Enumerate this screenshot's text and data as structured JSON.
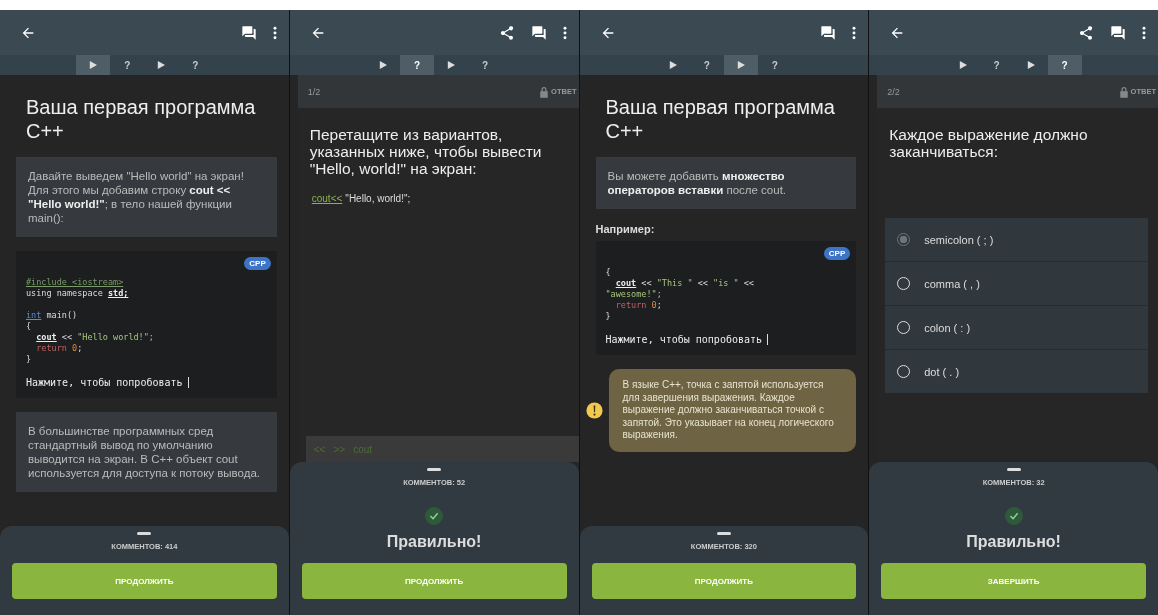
{
  "screens": [
    {
      "kind": "lesson",
      "share": false,
      "steps": [
        {
          "kind": "lesson",
          "selected": true
        },
        {
          "kind": "quiz",
          "label": "?",
          "selected": false
        },
        {
          "kind": "lesson",
          "selected": false
        },
        {
          "kind": "quiz",
          "label": "?",
          "selected": false
        }
      ],
      "title": "Ваша первая программа C++",
      "blocks": [
        {
          "kind": "note",
          "text": "Давайте выведем \"Hello world\" на экран! Для этого мы добавим строку **cout << \"Hello world!\"**; в тело нашей функции main():"
        },
        {
          "kind": "code",
          "lang": "CPP",
          "try_label": "Нажмите, чтобы попробовать",
          "lines": [
            {
              "indented": false,
              "blank_before": false,
              "tokens": [
                {
                  "text": "#include",
                  "kind": "ref"
                },
                {
                  "text": " <iostream>",
                  "kind": "ref"
                }
              ]
            },
            {
              "indented": false,
              "blank_before": false,
              "tokens": [
                {
                  "text": "using namespace ",
                  "kind": "plain"
                },
                {
                  "text": "std;",
                  "kind": "var"
                }
              ]
            },
            {
              "indented": false,
              "blank_before": true,
              "tokens": [
                {
                  "text": "int",
                  "kind": "type"
                },
                {
                  "text": " main()",
                  "kind": "plain"
                }
              ]
            },
            {
              "indented": false,
              "blank_before": false,
              "tokens": [
                {
                  "text": "{",
                  "kind": "plain"
                }
              ]
            },
            {
              "indented": true,
              "blank_before": false,
              "tokens": [
                {
                  "text": "cout",
                  "kind": "var"
                },
                {
                  "text": " << ",
                  "kind": "plain"
                },
                {
                  "text": "\"Hello world!\";",
                  "kind": "string"
                }
              ]
            },
            {
              "indented": true,
              "blank_before": false,
              "tokens": [
                {
                  "text": "return",
                  "kind": "keyword"
                },
                {
                  "text": " 0",
                  "kind": "number"
                },
                {
                  "text": ";",
                  "kind": "plain"
                }
              ]
            },
            {
              "indented": false,
              "blank_before": false,
              "tokens": [
                {
                  "text": "}",
                  "kind": "plain"
                }
              ]
            }
          ]
        },
        {
          "kind": "note",
          "text": "В большинстве программных сред стандартный вывод по умолчанию выводится на экран. В C++ объект cout используется для доступа к потоку вывода."
        }
      ],
      "comments": "КОММЕНТОВ: 414",
      "button": "ПРОДОЛЖИТЬ"
    },
    {
      "kind": "quiz",
      "share": true,
      "steps": [
        {
          "kind": "lesson",
          "selected": false
        },
        {
          "kind": "quiz",
          "label": "?",
          "selected": true
        },
        {
          "kind": "lesson",
          "selected": false
        },
        {
          "kind": "quiz",
          "label": "?",
          "selected": false
        }
      ],
      "counter": "1/2",
      "answer_label": "ОТВЕТ",
      "question": "Перетащите из вариантов, указанных ниже, чтобы вывести \"Hello, world!\" на экран:",
      "task": {
        "kind": "fill",
        "answer": [
          {
            "text": "cout<<",
            "kind": "filled"
          },
          {
            "text": "\"Hello, world!\";",
            "kind": "fixed"
          }
        ],
        "choices": [
          "<<",
          ">>",
          "cout"
        ]
      },
      "result": "Правильно!",
      "comments": "КОММЕНТОВ: 52",
      "button": "ПРОДОЛЖИТЬ"
    },
    {
      "kind": "lesson",
      "share": false,
      "steps": [
        {
          "kind": "lesson",
          "selected": false
        },
        {
          "kind": "quiz",
          "label": "?",
          "selected": false
        },
        {
          "kind": "lesson",
          "selected": true
        },
        {
          "kind": "quiz",
          "label": "?",
          "selected": false
        }
      ],
      "title": "Ваша первая программа C++",
      "blocks": [
        {
          "kind": "note",
          "text": "Вы можете добавить **множество операторов вставки** после cout."
        },
        {
          "kind": "label",
          "text": "Например:"
        },
        {
          "kind": "code",
          "lang": "CPP",
          "try_label": "Нажмите, чтобы попробовать",
          "lines": [
            {
              "indented": false,
              "blank_before": false,
              "tokens": [
                {
                  "text": "{",
                  "kind": "plain"
                }
              ]
            },
            {
              "indented": true,
              "blank_before": false,
              "tokens": [
                {
                  "text": "cout",
                  "kind": "var"
                },
                {
                  "text": " << ",
                  "kind": "plain"
                },
                {
                  "text": "\"This \"",
                  "kind": "string"
                },
                {
                  "text": " << ",
                  "kind": "plain"
                },
                {
                  "text": "\"is \"",
                  "kind": "string"
                },
                {
                  "text": " <<",
                  "kind": "plain"
                }
              ]
            },
            {
              "indented": false,
              "blank_before": false,
              "tokens": [
                {
                  "text": "\"awesome!\";",
                  "kind": "string"
                }
              ]
            },
            {
              "indented": true,
              "blank_before": false,
              "tokens": [
                {
                  "text": "return",
                  "kind": "keyword"
                },
                {
                  "text": " 0",
                  "kind": "number"
                },
                {
                  "text": ";",
                  "kind": "plain"
                }
              ]
            },
            {
              "indented": false,
              "blank_before": false,
              "tokens": [
                {
                  "text": "}",
                  "kind": "plain"
                }
              ]
            }
          ]
        },
        {
          "kind": "hint",
          "text": "В языке C++, точка с запятой используется для завершения выражения. Каждое выражение должно заканчиваться точкой с запятой. Это указывает на конец логического выражения."
        }
      ],
      "comments": "КОММЕНТОВ: 320",
      "button": "ПРОДОЛЖИТЬ"
    },
    {
      "kind": "quiz",
      "share": true,
      "steps": [
        {
          "kind": "lesson",
          "selected": false
        },
        {
          "kind": "quiz",
          "label": "?",
          "selected": false
        },
        {
          "kind": "lesson",
          "selected": false
        },
        {
          "kind": "quiz",
          "label": "?",
          "selected": true
        }
      ],
      "counter": "2/2",
      "answer_label": "ОТВЕТ",
      "question": "Каждое выражение должно заканчиваться:",
      "task": {
        "kind": "choice",
        "options": [
          {
            "label": "semicolon ( ; )",
            "selected": true
          },
          {
            "label": "comma ( , )",
            "selected": false
          },
          {
            "label": "colon ( : )",
            "selected": false
          },
          {
            "label": "dot ( . )",
            "selected": false
          }
        ]
      },
      "result": "Правильно!",
      "comments": "КОММЕНТОВ: 32",
      "button": "ЗАВЕРШИТЬ"
    }
  ]
}
